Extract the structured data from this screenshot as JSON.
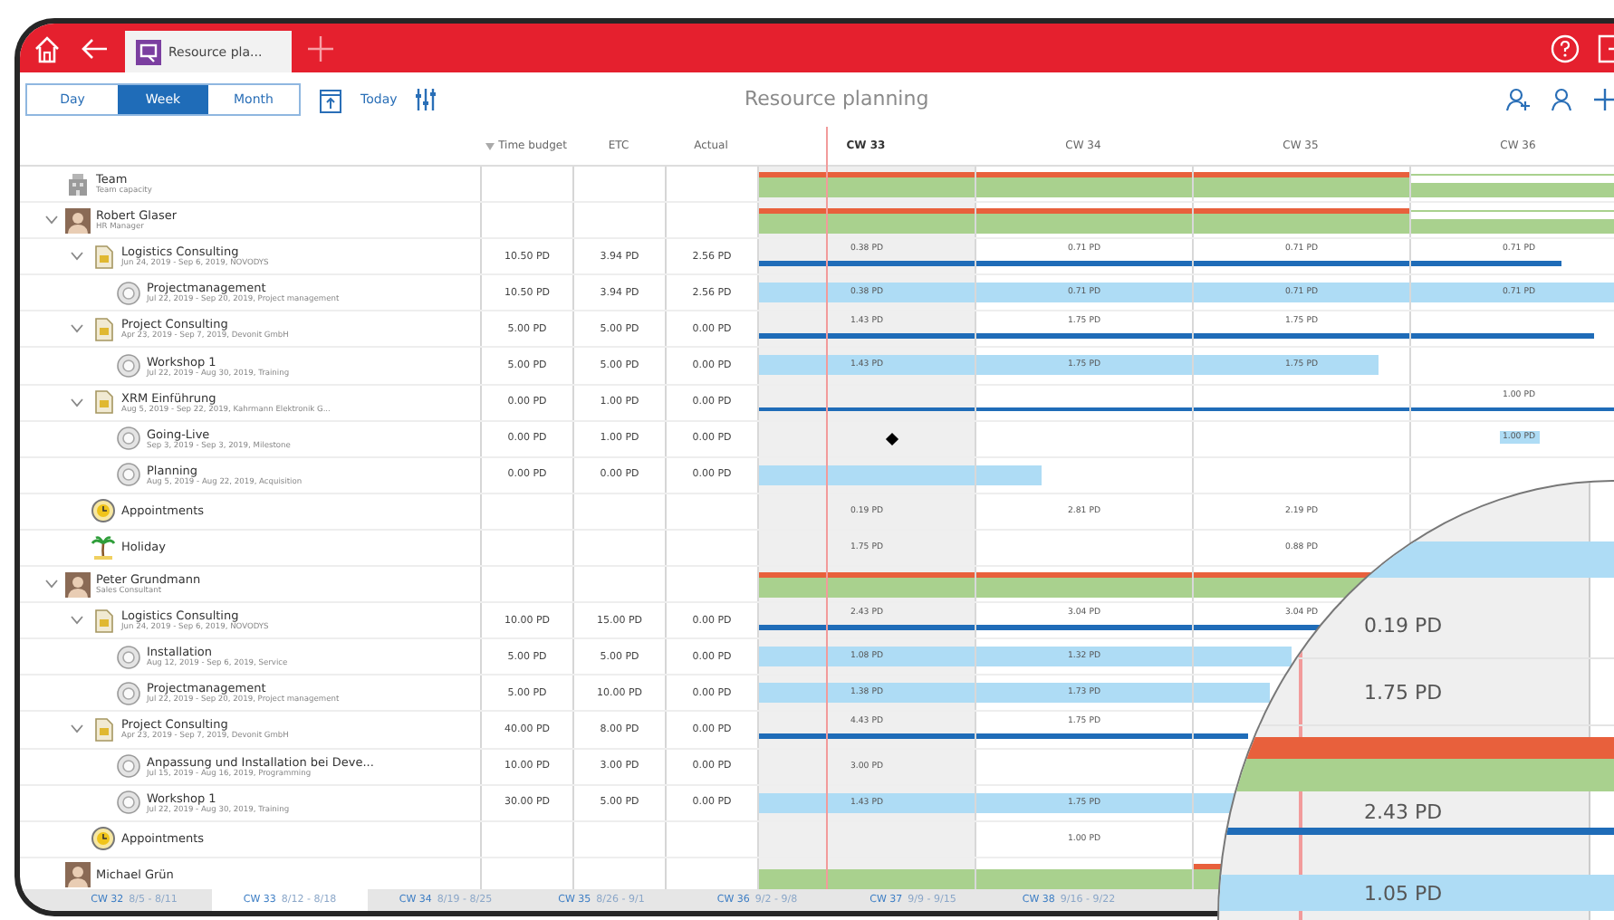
{
  "titlebar": {
    "tab": {
      "label": "Resource pla..."
    }
  },
  "toolbar": {
    "views": [
      {
        "label": "Day",
        "selected": false
      },
      {
        "label": "Week",
        "selected": true
      },
      {
        "label": "Month",
        "selected": false
      }
    ],
    "today_link": "Today",
    "title": "Resource planning"
  },
  "columns": [
    {
      "label": "Time budget",
      "sorted": true
    },
    {
      "label": "ETC",
      "sorted": false
    },
    {
      "label": "Actual",
      "sorted": false
    }
  ],
  "weeks": [
    {
      "label": "CW 33",
      "current": true
    },
    {
      "label": "CW 34",
      "current": false
    },
    {
      "label": "CW 35",
      "current": false
    },
    {
      "label": "CW 36",
      "current": false
    }
  ],
  "resources": [
    {
      "kind": "team",
      "title": "Team",
      "subtitle": "Team capacity",
      "weeks": {
        "week_1": {
          "kind": "over"
        },
        "week_2": {
          "kind": "over"
        },
        "week_3": {
          "kind": "over"
        },
        "week_4": {
          "kind": "free"
        }
      }
    },
    {
      "kind": "person",
      "title": "Robert Glaser",
      "subtitle": "HR Manager",
      "expanded": true,
      "weeks": {
        "week_1": {
          "kind": "over"
        },
        "week_2": {
          "kind": "over"
        },
        "week_3": {
          "kind": "over"
        },
        "week_4": {
          "kind": "free"
        }
      },
      "children": [
        {
          "kind": "project",
          "title": "Logistics Consulting",
          "subtitle": "Jun 24, 2019 - Sep 6, 2019, NOVODYS",
          "expanded": true,
          "budget": "10.50 PD",
          "etc": "3.94 PD",
          "actual": "2.56 PD",
          "weeks": {
            "week_1": {
              "text": "0.38 PD",
              "level": 1
            },
            "week_2": {
              "text": "0.71 PD",
              "level": 1
            },
            "week_3": {
              "text": "0.71 PD",
              "level": 1
            },
            "week_4": {
              "text": "0.71 PD",
              "level": 0.7
            }
          },
          "children": [
            {
              "kind": "task",
              "title": "Projectmanagement",
              "subtitle": "Jul 22, 2019 - Sep 20, 2019, Project management",
              "budget": "10.50 PD",
              "etc": "3.94 PD",
              "actual": "2.56 PD",
              "weeks": {
                "week_1": {
                  "text": "0.38 PD",
                  "level": 1
                },
                "week_2": {
                  "text": "0.71 PD",
                  "level": 1
                },
                "week_3": {
                  "text": "0.71 PD",
                  "level": 1
                },
                "week_4": {
                  "text": "0.71 PD",
                  "level": 1
                }
              }
            }
          ]
        },
        {
          "kind": "project",
          "title": "Project Consulting",
          "subtitle": "Apr 23, 2019 - Sep 7, 2019, Devonit GmbH",
          "expanded": true,
          "budget": "5.00 PD",
          "etc": "5.00 PD",
          "actual": "0.00 PD",
          "weeks": {
            "week_1": {
              "text": "1.43 PD",
              "level": 1
            },
            "week_2": {
              "text": "1.75 PD",
              "level": 1
            },
            "week_3": {
              "text": "1.75 PD",
              "level": 1
            },
            "week_4": {
              "level": 0.85
            }
          },
          "children": [
            {
              "kind": "task",
              "title": "Workshop 1",
              "subtitle": "Jul 22, 2019 - Aug 30, 2019, Training",
              "budget": "5.00 PD",
              "etc": "5.00 PD",
              "actual": "0.00 PD",
              "weeks": {
                "week_1": {
                  "text": "1.43 PD",
                  "level": 1
                },
                "week_2": {
                  "text": "1.75 PD",
                  "level": 1
                },
                "week_3": {
                  "text": "1.75 PD",
                  "level": 0.86
                }
              }
            }
          ]
        },
        {
          "kind": "project",
          "title": "XRM Einführung",
          "subtitle": "Aug 5, 2019 - Sep 22, 2019, Kahrmann Elektronik G...",
          "expanded": true,
          "budget": "0.00 PD",
          "etc": "1.00 PD",
          "actual": "0.00 PD",
          "weeks": {
            "week_1": {
              "level": 1
            },
            "week_2": {
              "level": 1
            },
            "week_3": {
              "level": 1
            },
            "week_4": {
              "text": "1.00 PD",
              "level": 1
            }
          },
          "children": [
            {
              "kind": "task",
              "title": "Going-Live",
              "subtitle": "Sep 3, 2019 - Sep 3, 2019, Milestone",
              "budget": "0.00 PD",
              "etc": "1.00 PD",
              "actual": "0.00 PD",
              "weeks": {
                "week_1": {
                  "milestone": true
                },
                "week_4": {
                  "text": "1.00 PD",
                  "chip": true
                }
              }
            },
            {
              "kind": "task",
              "title": "Planning",
              "subtitle": "Aug 5, 2019 - Aug 22, 2019, Acquisition",
              "budget": "0.00 PD",
              "etc": "0.00 PD",
              "actual": "0.00 PD",
              "weeks": {
                "week_1": {
                  "level": 1
                },
                "week_2": {
                  "level": 0.3
                }
              }
            }
          ]
        },
        {
          "kind": "appointments",
          "title": "Appointments",
          "weeks": {
            "week_1": {
              "text": "0.19 PD"
            },
            "week_2": {
              "text": "2.81 PD"
            },
            "week_3": {
              "text": "2.19 PD"
            }
          }
        },
        {
          "kind": "holiday",
          "title": "Holiday",
          "weeks": {
            "week_1": {
              "text": "1.75 PD"
            },
            "week_3": {
              "text": "0.88 PD"
            }
          }
        }
      ]
    },
    {
      "kind": "person",
      "title": "Peter Grundmann",
      "subtitle": "Sales Consultant",
      "expanded": true,
      "weeks": {
        "week_1": {
          "kind": "over"
        },
        "week_2": {
          "kind": "over"
        },
        "week_3": {
          "kind": "over"
        }
      },
      "children": [
        {
          "kind": "project",
          "title": "Logistics Consulting",
          "subtitle": "Jun 24, 2019 - Sep 6, 2019, NOVODYS",
          "expanded": true,
          "budget": "10.00 PD",
          "etc": "15.00 PD",
          "actual": "0.00 PD",
          "weeks": {
            "week_1": {
              "text": "2.43 PD",
              "level": 1
            },
            "week_2": {
              "text": "3.04 PD",
              "level": 1
            },
            "week_3": {
              "text": "3.04 PD",
              "level": 0.6
            }
          },
          "children": [
            {
              "kind": "task",
              "title": "Installation",
              "subtitle": "Aug 12, 2019 - Sep 6, 2019, Service",
              "budget": "5.00 PD",
              "etc": "5.00 PD",
              "actual": "0.00 PD",
              "weeks": {
                "week_1": {
                  "text": "1.08 PD",
                  "level": 1
                },
                "week_2": {
                  "text": "1.32 PD",
                  "level": 1
                },
                "week_3": {
                  "level": 0.45
                }
              }
            },
            {
              "kind": "task",
              "title": "Projectmanagement",
              "subtitle": "Jul 22, 2019 - Sep 20, 2019, Project management",
              "budget": "5.00 PD",
              "etc": "10.00 PD",
              "actual": "0.00 PD",
              "weeks": {
                "week_1": {
                  "text": "1.38 PD",
                  "level": 1
                },
                "week_2": {
                  "text": "1.73 PD",
                  "level": 1
                },
                "week_3": {
                  "level": 0.35
                }
              }
            }
          ]
        },
        {
          "kind": "project",
          "title": "Project Consulting",
          "subtitle": "Apr 23, 2019 - Sep 7, 2019, Devonit GmbH",
          "expanded": true,
          "budget": "40.00 PD",
          "etc": "8.00 PD",
          "actual": "0.00 PD",
          "weeks": {
            "week_1": {
              "text": "4.43 PD",
              "level": 1
            },
            "week_2": {
              "text": "1.75 PD",
              "level": 1
            },
            "week_3": {
              "level": 0.25
            }
          },
          "children": [
            {
              "kind": "task",
              "title": "Anpassung und Installation bei Deve...",
              "subtitle": "Jul 15, 2019 - Aug 16, 2019, Programming",
              "budget": "10.00 PD",
              "etc": "3.00 PD",
              "actual": "0.00 PD",
              "weeks": {
                "week_1": {
                  "text": "3.00 PD"
                }
              }
            },
            {
              "kind": "task",
              "title": "Workshop 1",
              "subtitle": "Jul 22, 2019 - Aug 30, 2019, Training",
              "budget": "30.00 PD",
              "etc": "5.00 PD",
              "actual": "0.00 PD",
              "weeks": {
                "week_1": {
                  "text": "1.43 PD",
                  "level": 1
                },
                "week_2": {
                  "text": "1.75 PD",
                  "level": 1
                },
                "week_3": {
                  "level": 0.2
                }
              }
            }
          ]
        },
        {
          "kind": "appointments",
          "title": "Appointments",
          "weeks": {
            "week_2": {
              "text": "1.00 PD"
            }
          }
        }
      ]
    },
    {
      "kind": "person",
      "title": "Michael Grün",
      "weeks": {
        "week_1": {
          "kind": "ok"
        },
        "week_2": {
          "kind": "ok"
        },
        "week_3": {
          "kind": "over"
        }
      }
    }
  ],
  "weekbar": [
    {
      "week": "CW 32",
      "dates": "8/5 - 8/11",
      "selected": false
    },
    {
      "week": "CW 33",
      "dates": "8/12 - 8/18",
      "selected": true
    },
    {
      "week": "CW 34",
      "dates": "8/19 - 8/25",
      "selected": false
    },
    {
      "week": "CW 35",
      "dates": "8/26 - 9/1",
      "selected": false
    },
    {
      "week": "CW 36",
      "dates": "9/2 - 9/8",
      "selected": false
    },
    {
      "week": "CW 37",
      "dates": "9/9 - 9/15",
      "selected": false
    },
    {
      "week": "CW 38",
      "dates": "9/16 - 9/22",
      "selected": false
    }
  ],
  "magnifier": {
    "rows": [
      {
        "kind": "task"
      },
      {
        "kind": "value",
        "text": "0.19 PD"
      },
      {
        "kind": "value",
        "text": "1.75 PD"
      },
      {
        "kind": "capacity"
      },
      {
        "kind": "summary",
        "text": "2.43 PD"
      },
      {
        "kind": "task",
        "text": "1.05 PD"
      }
    ]
  }
}
